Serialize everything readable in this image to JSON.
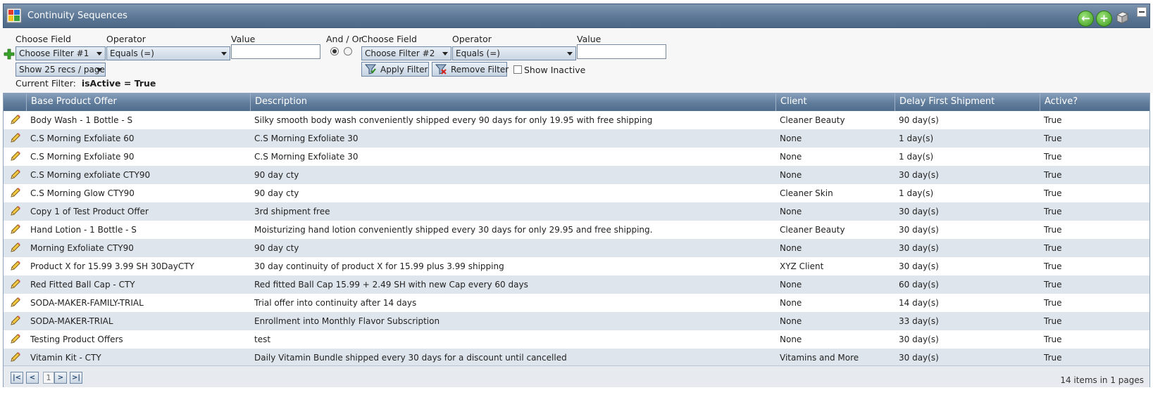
{
  "window": {
    "title": "Continuity Sequences"
  },
  "filters": {
    "left": {
      "field_label": "Choose Field",
      "operator_label": "Operator",
      "value_label": "Value",
      "field_value": "Choose Filter #1",
      "operator_value": "Equals (=)",
      "value_input": ""
    },
    "andor_label": "And / Or",
    "right": {
      "field_label": "Choose Field",
      "operator_label": "Operator",
      "value_label": "Value",
      "field_value": "Choose Filter #2",
      "operator_value": "Equals (=)",
      "value_input": ""
    },
    "page_size": "Show 25 recs / page",
    "apply_label": "Apply Filter",
    "remove_label": "Remove Filter",
    "show_inactive_label": "Show Inactive",
    "current_filter_label": "Current Filter:",
    "current_filter_value": "isActive = True"
  },
  "grid": {
    "columns": [
      "Base Product Offer",
      "Description",
      "Client",
      "Delay First Shipment",
      "Active?"
    ],
    "rows": [
      [
        "Body Wash - 1 Bottle - S",
        "Silky smooth body wash conveniently shipped every 90 days for only 19.95 with free shipping",
        "Cleaner Beauty",
        "90 day(s)",
        "True"
      ],
      [
        "C.S Morning Exfoliate 60",
        "C.S Morning Exfoliate 30",
        "None",
        "1 day(s)",
        "True"
      ],
      [
        "C.S Morning Exfoliate 90",
        "C.S Morning Exfoliate 30",
        "None",
        "1 day(s)",
        "True"
      ],
      [
        "C.S Morning exfoliate CTY90",
        "90 day cty",
        "None",
        "30 day(s)",
        "True"
      ],
      [
        "C.S Morning Glow CTY90",
        "90 day cty",
        "Cleaner Skin",
        "1 day(s)",
        "True"
      ],
      [
        "Copy 1 of Test Product Offer",
        "3rd shipment free",
        "None",
        "30 day(s)",
        "True"
      ],
      [
        "Hand Lotion - 1 Bottle - S",
        "Moisturizing hand lotion conveniently shipped every 30 days for only 29.95 and free shipping.",
        "Cleaner Beauty",
        "30 day(s)",
        "True"
      ],
      [
        "Morning Exfoliate CTY90",
        "90 day cty",
        "None",
        "30 day(s)",
        "True"
      ],
      [
        "Product X for 15.99 3.99 SH 30DayCTY",
        "30 day continuity of product X for 15.99 plus 3.99 shipping",
        "XYZ Client",
        "30 day(s)",
        "True"
      ],
      [
        "Red Fitted Ball Cap - CTY",
        "Red fitted Ball Cap 15.99 + 2.49 SH with new Cap every 60 days",
        "None",
        "60 day(s)",
        "True"
      ],
      [
        "SODA-MAKER-FAMILY-TRIAL",
        "Trial offer into continuity after 14 days",
        "None",
        "14 day(s)",
        "True"
      ],
      [
        "SODA-MAKER-TRIAL",
        "Enrollment into Monthly Flavor Subscription",
        "None",
        "33 day(s)",
        "True"
      ],
      [
        "Testing Product Offers",
        "test",
        "None",
        "30 day(s)",
        "True"
      ],
      [
        "Vitamin Kit - CTY",
        "Daily Vitamin Bundle shipped every 30 days for a discount until cancelled",
        "Vitamins and More",
        "30 day(s)",
        "True"
      ]
    ]
  },
  "pager": {
    "current_page": "1",
    "summary": "14 items in 1 pages"
  },
  "colors": {
    "header": "#607c9b",
    "alt_row": "#dfe5ec",
    "accent": "#3d9a1c"
  }
}
